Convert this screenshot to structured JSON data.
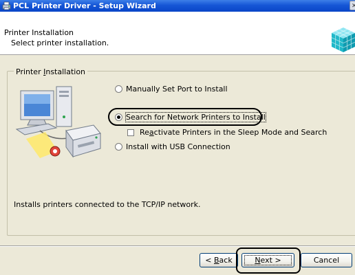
{
  "window": {
    "title": "PCL Printer Driver - Setup Wizard",
    "title_bar_color": "#0a46c8"
  },
  "header": {
    "title": "Printer Installation",
    "subtitle": "Select printer installation."
  },
  "group": {
    "legend_pre": "Printer ",
    "legend_accel": "I",
    "legend_post": "nstallation"
  },
  "options": {
    "manual": {
      "label": "Manually Set Port to Install",
      "checked": false
    },
    "network": {
      "label": "Search for Network Printers to Install",
      "checked": true
    },
    "reactivate": {
      "label_pre": "Re",
      "label_accel": "a",
      "label_post": "ctivate Printers in the Sleep Mode and Search",
      "checked": false
    },
    "usb": {
      "label": "Install with USB Connection",
      "checked": false
    }
  },
  "description": "Installs printers connected to the TCP/IP network.",
  "buttons": {
    "back": {
      "pre": "< ",
      "accel": "B",
      "post": "ack"
    },
    "next": {
      "pre": "",
      "accel": "N",
      "post": "ext >"
    },
    "cancel": "Cancel"
  },
  "icons": {
    "title": "printer-icon",
    "header": "cube-icon",
    "illustration": "computer-printer-illustration"
  }
}
